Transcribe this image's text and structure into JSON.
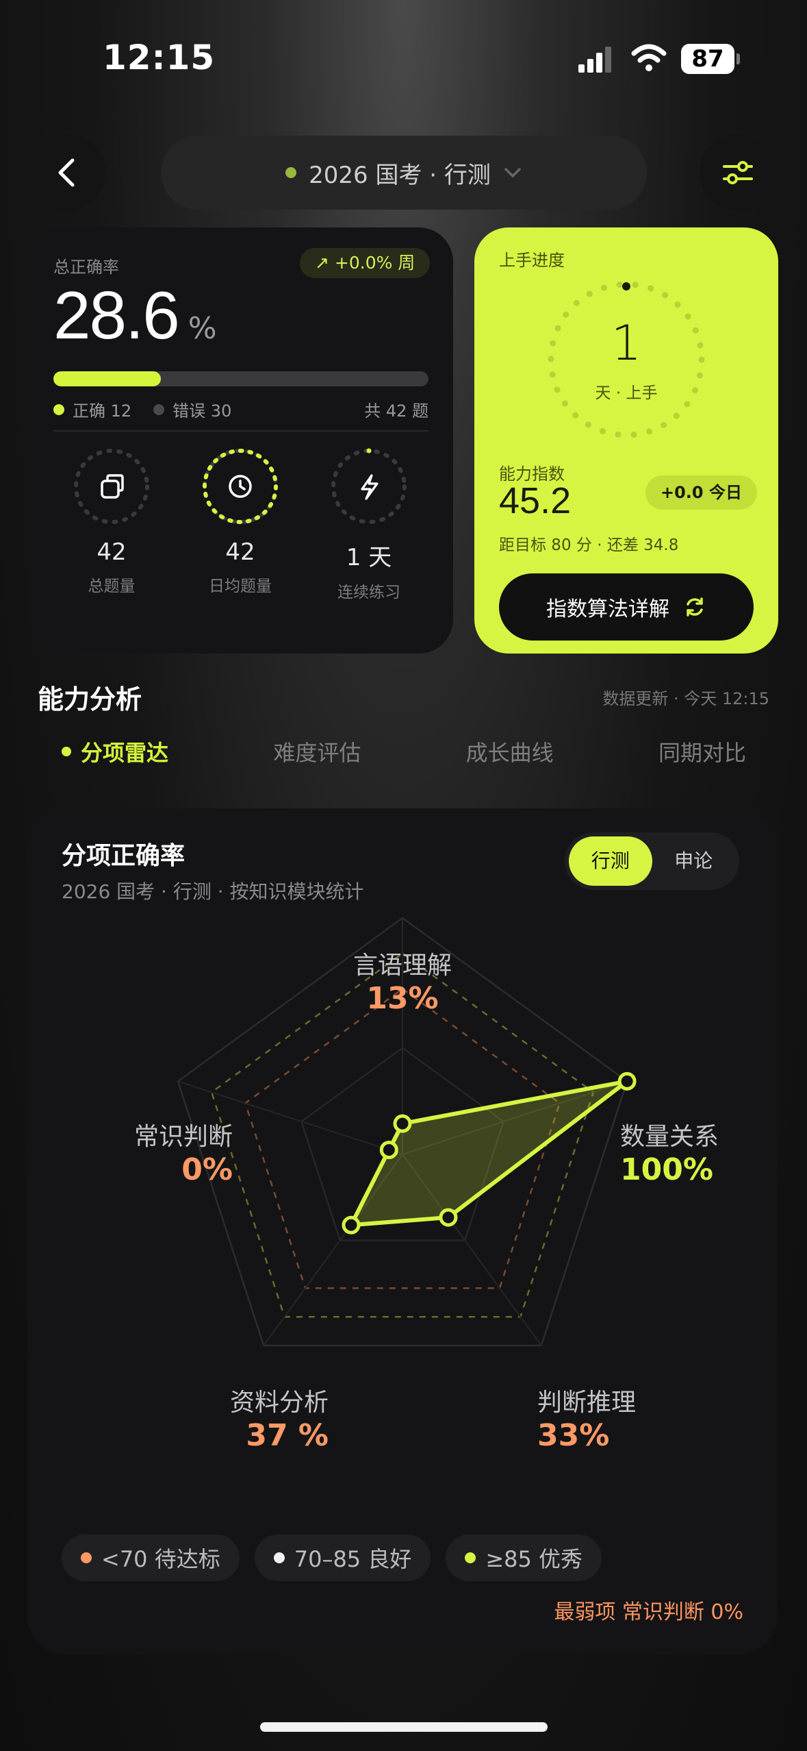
{
  "status": {
    "time": "12:15",
    "battery": "87"
  },
  "header": {
    "title": "2026 国考 · 行测"
  },
  "accuracy": {
    "label": "总正确率",
    "value": "28.6",
    "unit": "%",
    "week_change": "↗ +0.0% 周",
    "progress": 0.286,
    "correct_label": "正确 12",
    "wrong_label": "错误 30",
    "total_label": "共 42 题"
  },
  "stats": [
    {
      "value": "42",
      "label": "总题量",
      "icon": "copy-icon"
    },
    {
      "value": "42",
      "label": "日均题量",
      "icon": "clock-icon"
    },
    {
      "value": "1 天",
      "label": "连续练习",
      "icon": "bolt-icon"
    }
  ],
  "onboarding": {
    "label": "上手进度",
    "days": "1",
    "sub": "天 · 上手",
    "ability_label": "能力指数",
    "ability_value": "45.2",
    "today_change": "+0.0 今日",
    "target_text": "距目标 80 分 · 还差 34.8",
    "button_label": "指数算法详解"
  },
  "analysis": {
    "title": "能力分析",
    "updated": "数据更新 · 今天 12:15",
    "tabs": [
      "分项雷达",
      "难度评估",
      "成长曲线",
      "同期对比"
    ]
  },
  "radar_card": {
    "title": "分项正确率",
    "subtitle": "2026 国考 · 行测 · 按知识模块统计",
    "seg": [
      "行测",
      "申论"
    ],
    "labels": [
      {
        "name": "言语理解",
        "value": "13%",
        "color": "#ff9a66"
      },
      {
        "name": "数量关系",
        "value": "100%",
        "color": "#d6f542"
      },
      {
        "name": "判断推理",
        "value": "33%",
        "color": "#ff9a66"
      },
      {
        "name": "资料分析",
        "value": "37 %",
        "color": "#ff9a66"
      },
      {
        "name": "常识判断",
        "value": "0%",
        "color": "#ff9a66"
      }
    ],
    "legend": [
      "<70 待达标",
      "70–85 良好",
      "≥85 优秀"
    ],
    "legend_colors": [
      "#ff9a66",
      "#f2f2f2",
      "#d6f542"
    ],
    "weakest": "最弱项 常识判断 0%"
  },
  "chart_data": {
    "type": "radar",
    "categories": [
      "言语理解",
      "数量关系",
      "判断推理",
      "资料分析",
      "常识判断"
    ],
    "values": [
      13,
      100,
      33,
      37,
      0
    ],
    "ylim": [
      0,
      100
    ],
    "color": "#d6f542"
  }
}
